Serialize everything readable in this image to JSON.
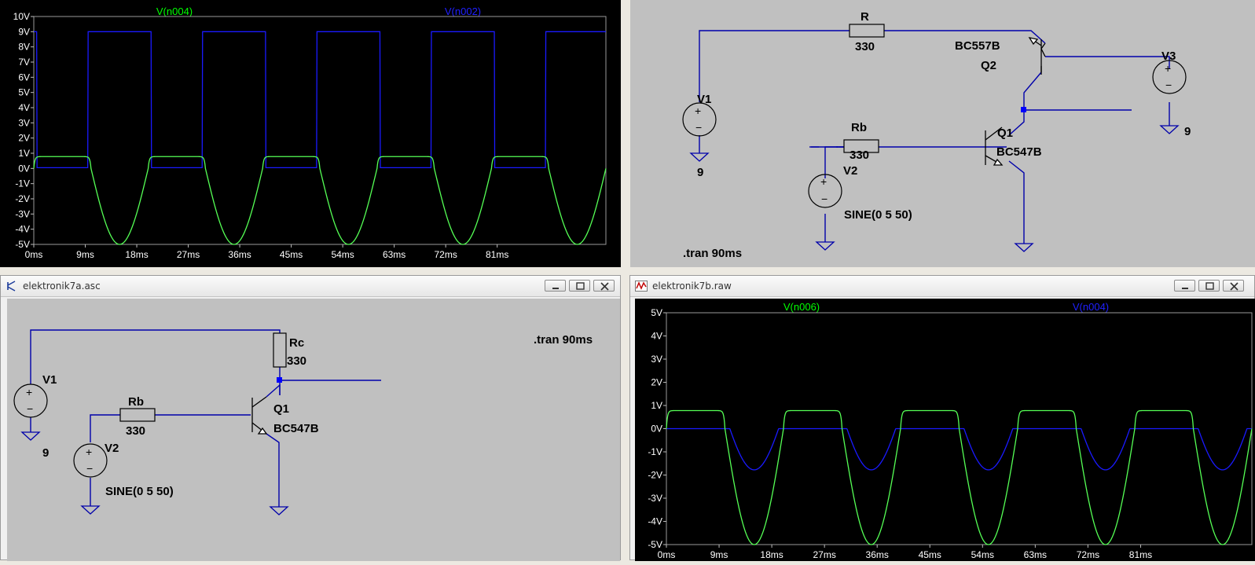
{
  "windows": {
    "top_left_plot": {
      "traces": [
        {
          "name": "V(n004)",
          "color": "#00ff00"
        },
        {
          "name": "V(n002)",
          "color": "#0000ff"
        }
      ],
      "y_ticks": [
        "10V",
        "9V",
        "8V",
        "7V",
        "6V",
        "5V",
        "4V",
        "3V",
        "2V",
        "1V",
        "0V",
        "-1V",
        "-2V",
        "-3V",
        "-4V",
        "-5V"
      ],
      "x_ticks": [
        "0ms",
        "9ms",
        "18ms",
        "27ms",
        "36ms",
        "45ms",
        "54ms",
        "63ms",
        "72ms",
        "81ms"
      ]
    },
    "top_right_schematic": {
      "components": {
        "r_label": "R",
        "r_value": "330",
        "q2_model": "BC557B",
        "q2_label": "Q2",
        "v3_label": "V3",
        "v3_value": "9",
        "v1_label": "V1",
        "v1_value": "9",
        "rb_label": "Rb",
        "rb_value": "330",
        "q1_label": "Q1",
        "q1_model": "BC547B",
        "v2_label": "V2",
        "v2_value": "SINE(0 5 50)"
      },
      "directive": ".tran 90ms"
    },
    "bottom_left_schematic": {
      "title": "elektronik7a.asc",
      "components": {
        "v1_label": "V1",
        "v1_value": "9",
        "rc_label": "Rc",
        "rc_value": "330",
        "rb_label": "Rb",
        "rb_value": "330",
        "q1_label": "Q1",
        "q1_model": "BC547B",
        "v2_label": "V2",
        "v2_value": "SINE(0 5 50)"
      },
      "directive": ".tran 90ms"
    },
    "bottom_right_plot": {
      "title": "elektronik7b.raw",
      "traces": [
        {
          "name": "V(n006)",
          "color": "#00ff00"
        },
        {
          "name": "V(n004)",
          "color": "#0000ff"
        }
      ],
      "y_ticks": [
        "5V",
        "4V",
        "3V",
        "2V",
        "1V",
        "0V",
        "-1V",
        "-2V",
        "-3V",
        "-4V",
        "-5V"
      ],
      "x_ticks": [
        "0ms",
        "9ms",
        "18ms",
        "27ms",
        "36ms",
        "45ms",
        "54ms",
        "63ms",
        "72ms",
        "81ms"
      ]
    }
  },
  "icons": {
    "schematic_window": "transistor-icon",
    "waveform_window": "waveform-icon",
    "minimize": "minimize-icon",
    "maximize": "maximize-icon",
    "close": "close-icon"
  },
  "colors": {
    "plot_background": "#000000",
    "schematic_background": "#c0c0c0",
    "wire": "#0000aa",
    "axis_text": "#ffffff"
  }
}
